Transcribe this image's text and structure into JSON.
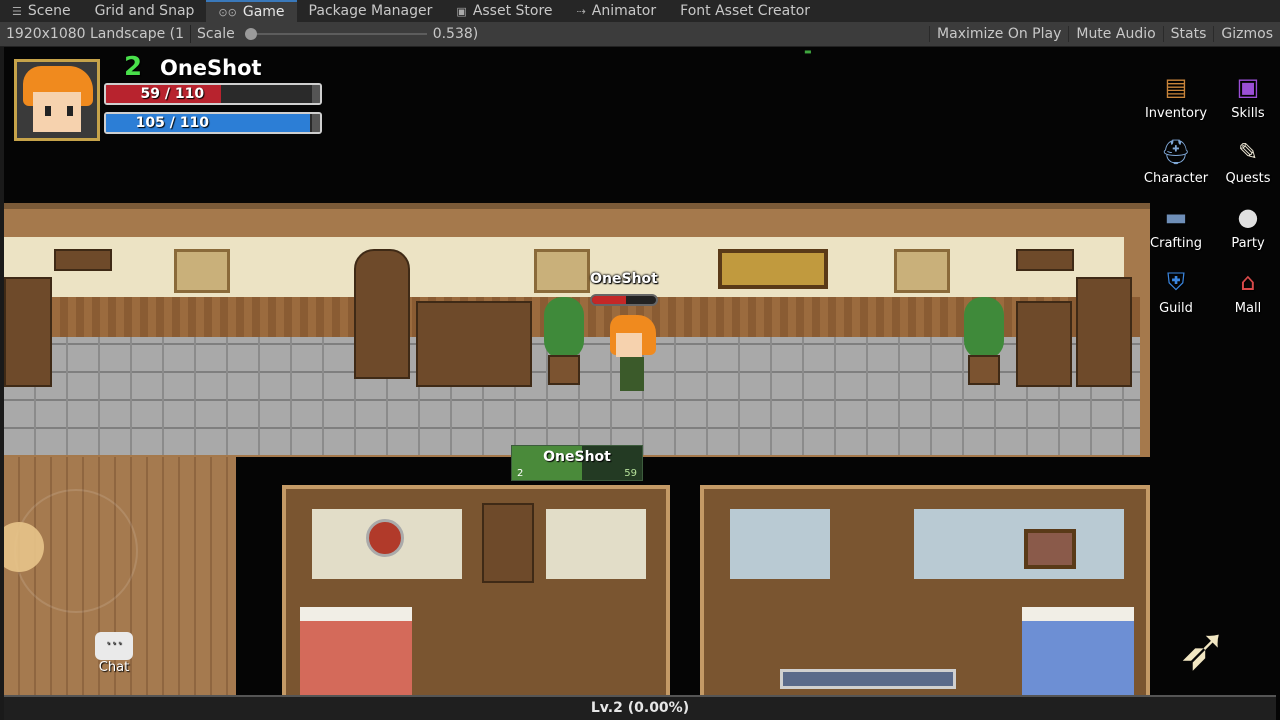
{
  "editor": {
    "tabs": [
      {
        "label": "Scene",
        "icon": "scene-icon"
      },
      {
        "label": "Grid and Snap",
        "icon": ""
      },
      {
        "label": "Game",
        "icon": "game-controller-icon",
        "active": true
      },
      {
        "label": "Package Manager",
        "icon": ""
      },
      {
        "label": "Asset Store",
        "icon": "shopping-bag-icon"
      },
      {
        "label": "Animator",
        "icon": "animator-icon"
      },
      {
        "label": "Font Asset Creator",
        "icon": ""
      }
    ],
    "toolbar": {
      "resolution": "1920x1080 Landscape (1",
      "scale_label": "Scale",
      "scale_value": "0.538)",
      "scale_fraction": 0.0,
      "maximize": "Maximize On Play",
      "mute": "Mute Audio",
      "stats": "Stats",
      "gizmos": "Gizmos"
    }
  },
  "hud": {
    "level": "2",
    "player_name": "OneShot",
    "hp_text": "59 / 110",
    "hp_fraction": 0.536,
    "mp_text": "105 / 110",
    "mp_fraction": 0.955,
    "hp_color": "#b8232e",
    "mp_color": "#2c7ed6"
  },
  "menu": [
    {
      "label": "Inventory",
      "icon": "inventory-chest-icon"
    },
    {
      "label": "Skills",
      "icon": "skills-book-icon"
    },
    {
      "label": "Character",
      "icon": "character-helmet-icon"
    },
    {
      "label": "Quests",
      "icon": "quests-scroll-icon"
    },
    {
      "label": "Crafting",
      "icon": "crafting-anvil-icon"
    },
    {
      "label": "Party",
      "icon": "party-person-icon"
    },
    {
      "label": "Guild",
      "icon": "guild-shield-icon"
    },
    {
      "label": "Mall",
      "icon": "mall-shop-icon"
    }
  ],
  "world": {
    "overhead_name": "OneShot",
    "overhead_hp_fraction": 0.536,
    "target_plate": {
      "name": "OneShot",
      "level": "2",
      "hp": "59",
      "hp_fraction": 0.536
    }
  },
  "controls": {
    "chat_label": "Chat",
    "attack_icon": "arrow-attack-icon"
  },
  "exp": {
    "text": "Lv.2 (0.00%)"
  }
}
